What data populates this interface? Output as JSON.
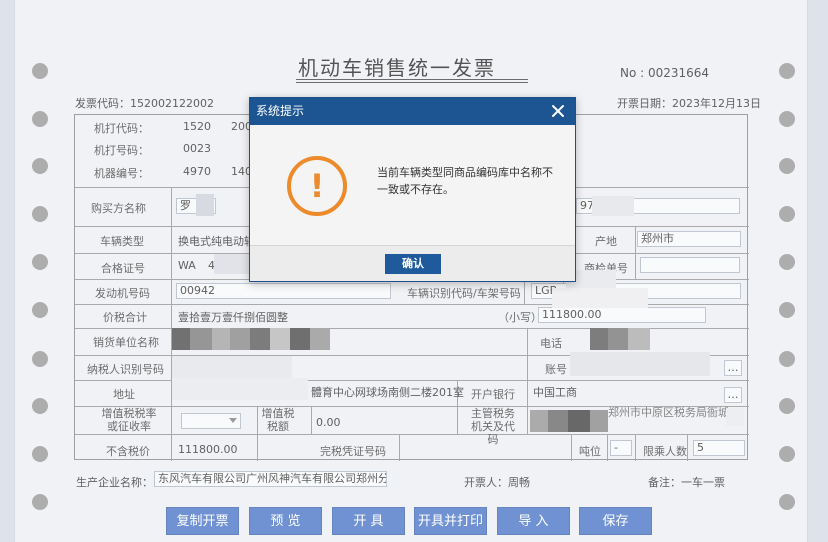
{
  "invoice": {
    "title": "机动车销售统一发票",
    "no_label": "No : 00231664",
    "code_label": "发票代码：152002122002",
    "date_label": "开票日期：2023年12月13日"
  },
  "fields": {
    "machine_code_label": "机打代码：",
    "machine_code_value": "1520",
    "machine_code_value2": "200",
    "machine_no_label": "机打号码：",
    "machine_no_value": "0023",
    "machine_id_label": "机器编号：",
    "machine_id_value": "4970",
    "machine_id_value2": "140",
    "buyer_label": "购买方名称",
    "buyer_value": "罗",
    "buyer_id_tail": "97",
    "vehicle_type_label": "车辆类型",
    "vehicle_type_value": "换电式纯电动轿",
    "origin_label": "产地",
    "origin_value": "郑州市",
    "cert_label": "合格证号",
    "cert_value": "WA",
    "cert_value2": "460000",
    "inspection_label": "商检单号",
    "engine_label": "发动机号码",
    "engine_value": "00942",
    "vin_label": "车辆识别代码/车架号码",
    "vin_value": "LGB",
    "total_label": "价税合计",
    "total_text": "壹拾壹万壹仟捌佰圆整",
    "small_label": "（小写）",
    "total_small": "111800.00",
    "seller_label": "销货单位名称",
    "phone_label": "电话",
    "taxid_label": "纳税人识别号码",
    "account_label": "账号",
    "address_label": "地址",
    "address_value": "體育中心网球场南侧二楼201室",
    "bank_label": "开户银行",
    "bank_value": "中国工商",
    "vat_rate_label": "增值税税率或征收率",
    "vat_amount_label": "增值税税额",
    "vat_amount_value": "0.00",
    "tax_office_label": "主管税务机关及代码",
    "tax_office_value": "郑州市中原区税务局衙城",
    "pretax_label": "不含税价",
    "pretax_value": "111800.00",
    "tax_cert_label": "完税凭证号码",
    "tonnage_label": "吨位",
    "tonnage_value": "-",
    "passengers_label": "限乘人数",
    "passengers_value": "5",
    "ellipsis": "…"
  },
  "footer": {
    "manufacturer_label": "生产企业名称：",
    "manufacturer_value": "东风汽车有限公司广州风神汽车有限公司郑州分公司",
    "issuer": "开票人：周畅",
    "remark": "备注：一车一票"
  },
  "buttons": {
    "copy": "复制开票",
    "preview": "预 览",
    "issue": "开 具",
    "issue_print": "开具并打印",
    "import": "导 入",
    "save": "保存"
  },
  "dialog": {
    "title": "系统提示",
    "message": "当前车辆类型同商品编码库中名称不一致或不存在。",
    "ok": "确认",
    "icon": "warning-icon",
    "accent": "#ec8a2c"
  }
}
